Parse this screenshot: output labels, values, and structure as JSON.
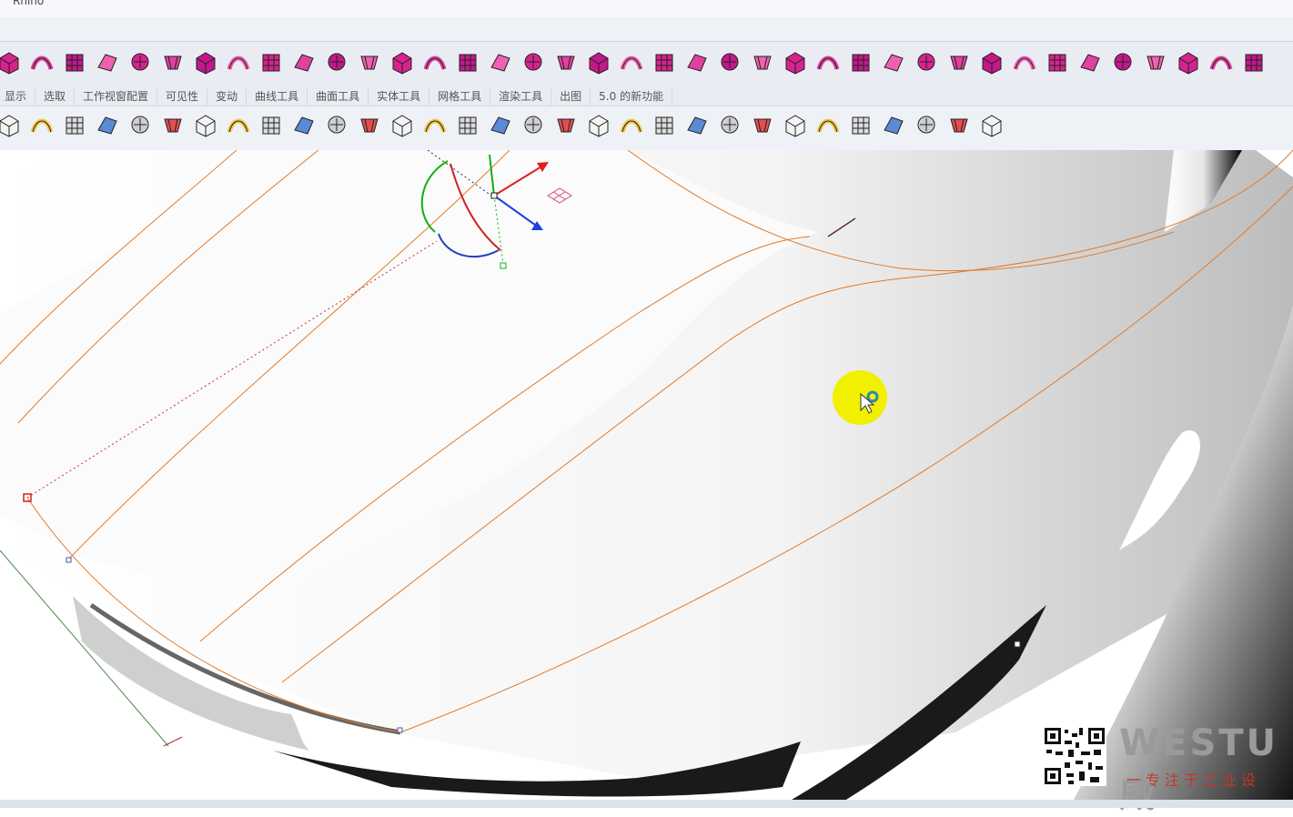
{
  "window": {
    "title": "Rhino"
  },
  "tabs": [
    "显示",
    "选取",
    "工作视窗配置",
    "可见性",
    "变动",
    "曲线工具",
    "曲面工具",
    "实体工具",
    "网格工具",
    "渲染工具",
    "出图",
    "5.0 的新功能"
  ],
  "toolbar1_icons": [
    "box-solid-icon",
    "surface-trim-icon",
    "network-surface-icon",
    "rotate-surface-icon",
    "sweep-icon",
    "arch-icon",
    "extrude-icon",
    "extrude-curve-icon",
    "box-magenta-icon",
    "grid-box-icon",
    "cube-magenta-icon",
    "bend-icon",
    "cage-edit-icon",
    "checkbox-green-icon",
    "grid-magenta-icon",
    "boolean-icon",
    "point-grid-icon",
    "rebuild-icon",
    "flow-icon",
    "bridge-icon",
    "blend-icon",
    "twist-icon",
    "mesh-icon",
    "dot-grid-icon",
    "fillet-surface-icon",
    "hand-magenta-icon",
    "split-icon",
    "branch-icon",
    "diamond-surface-icon",
    "gear-target-icon",
    "rotate-star-icon",
    "pentagon-icon",
    "contour-icon",
    "surface-flat-icon",
    "patch-icon",
    "mesh-grid-icon",
    "intersect-icon",
    "sphere-black-icon",
    "gear-magenta-icon"
  ],
  "toolbar2_icons": [
    "new-file-icon",
    "open-file-icon",
    "undo-icon",
    "pan-hand-icon",
    "rotate-view-icon",
    "zoom-icon",
    "zoom-window-icon",
    "zoom-extents-icon",
    "zoom-selected-icon",
    "target-icon",
    "rotate-camera-icon",
    "four-viewports-icon",
    "car-icon",
    "grid-plane-icon",
    "set-view-icon",
    "cplane-icon",
    "circle-point-icon",
    "triangle-points-icon",
    "lightbulb-icon",
    "lamp-color-icon",
    "lock-icon",
    "lock-select-icon",
    "material-icon",
    "color-wheel-icon",
    "sphere-gray-icon",
    "sphere-shaded-icon",
    "sphere-blue-icon",
    "spotlight-icon",
    "gear-settings-icon",
    "dimension-icon",
    "help-icon"
  ],
  "watermark": {
    "brand": "WESTU威",
    "tagline": "一专注于工业设"
  },
  "colors": {
    "accent_magenta": "#c2188b",
    "isocurve": "#e07b2c",
    "axis_red": "#e02020",
    "axis_green": "#10b010",
    "axis_blue": "#2040e0",
    "highlight": "#f0f000"
  }
}
